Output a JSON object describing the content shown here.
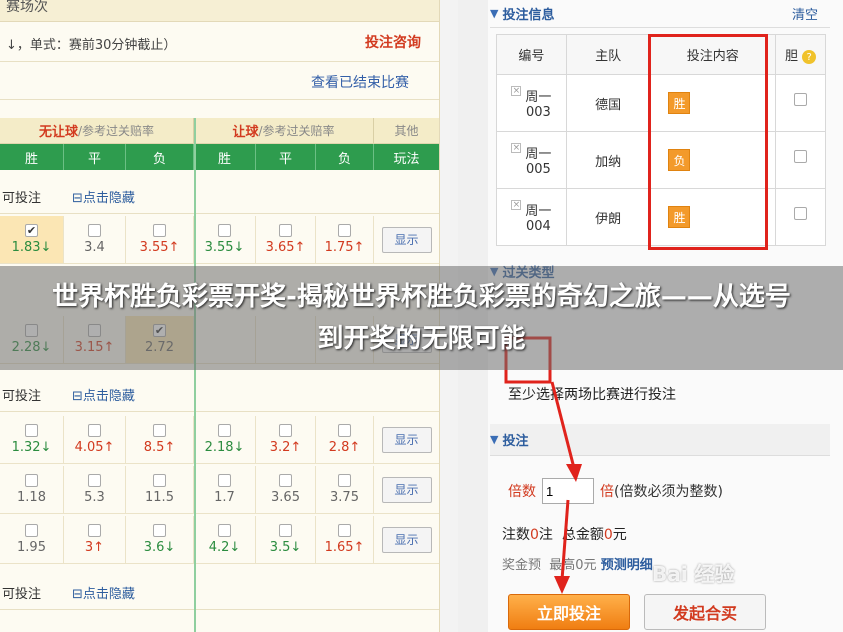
{
  "left": {
    "top_title": "赛场次",
    "rule_text": "↓，单式：赛前30分钟截止）",
    "consult_link": "投注咨询",
    "ended_link": "查看已结束比赛",
    "header1": {
      "no_handicap": "无让球",
      "no_handicap_sub": "/参考过关赔率",
      "handicap": "让球",
      "handicap_sub": "/参考过关赔率",
      "other": "其他"
    },
    "header2": [
      "胜",
      "平",
      "负",
      "胜",
      "平",
      "负",
      "玩法"
    ],
    "sections": [
      {
        "title": "可投注",
        "toggle": "⊟点击隐藏"
      },
      {
        "title": "可投注",
        "toggle": "⊟点击隐藏"
      },
      {
        "title": "可投注",
        "toggle": "⊟点击隐藏"
      }
    ],
    "show_btn": "显示",
    "rows": [
      {
        "odds": [
          "1.83↓",
          "3.4",
          "3.55↑",
          "3.55↓",
          "3.65↑",
          "1.75↑"
        ],
        "checked": [
          true,
          false,
          false,
          false,
          false,
          false
        ]
      },
      {
        "odds": [
          "2.28↓",
          "3.15↑",
          "2.72",
          "",
          "",
          ""
        ],
        "checked": [
          false,
          false,
          true,
          false,
          false,
          false
        ]
      },
      {
        "odds": [
          "1.32↓",
          "4.05↑",
          "8.5↑",
          "2.18↓",
          "3.2↑",
          "2.8↑"
        ],
        "checked": [
          false,
          false,
          false,
          false,
          false,
          false
        ]
      },
      {
        "odds": [
          "1.18",
          "5.3",
          "11.5",
          "1.7",
          "3.65",
          "3.75"
        ],
        "checked": [
          false,
          false,
          false,
          false,
          false,
          false
        ]
      },
      {
        "odds": [
          "1.95",
          "3↑",
          "3.6↓",
          "4.2↓",
          "3.5↓",
          "1.65↑"
        ],
        "checked": [
          false,
          false,
          false,
          false,
          false,
          false
        ]
      }
    ]
  },
  "right": {
    "bet_info_title": "投注信息",
    "clear": "清空",
    "table_headers": [
      "编号",
      "主队",
      "投注内容",
      "胆"
    ],
    "bets": [
      {
        "no": "周一\n003",
        "team": "德国",
        "pick": "胜"
      },
      {
        "no": "周一\n005",
        "team": "加纳",
        "pick": "负"
      },
      {
        "no": "周一\n004",
        "team": "伊朗",
        "pick": "胜"
      }
    ],
    "pass_type_title": "过关类型",
    "hint": "至少选择两场比赛进行投注",
    "bet_title": "投注",
    "multiple_label": "倍数",
    "multiple_value": "1",
    "multiple_unit": "倍",
    "multiple_note": "(倍数必须为整数)",
    "count_label": "注数",
    "count_value": "0",
    "count_unit": "注",
    "amount_label": "总金额",
    "amount_value": "0",
    "amount_unit": "元",
    "prize_label": "奖金预",
    "max_label": "最高0元",
    "detail_link": "预测明细",
    "submit_btn": "立即投注",
    "start_btn": "发起合买",
    "watermark": "Bai 经验"
  },
  "banner_title": "世界杯胜负彩票开奖-揭秘世界杯胜负彩票的奇幻之旅——从选号到开奖的无限可能"
}
